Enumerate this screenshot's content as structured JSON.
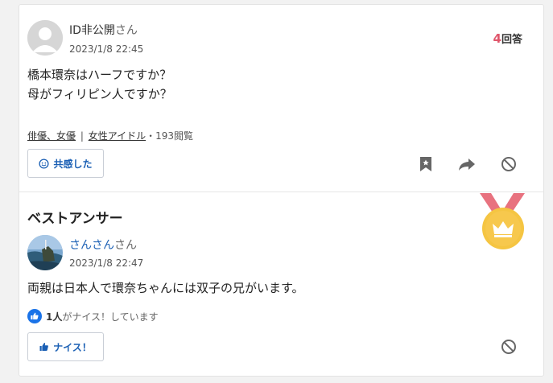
{
  "question": {
    "user_name": "ID非公開",
    "honorific": "さん",
    "date": "2023/1/8 22:45",
    "answer_count_number": "4",
    "answer_count_label": "回答",
    "text_line1": "橋本環奈はハーフですか？",
    "text_line2": "母がフィリピン人ですか？",
    "tag1": "俳優、女優",
    "separator": "|",
    "tag2": "女性アイドル",
    "views": "・193閲覧",
    "empathy_label": "共感した"
  },
  "best_answer": {
    "section_title": "ベストアンサー",
    "user_name": "さんさん",
    "honorific": "さん",
    "date": "2023/1/8 22:47",
    "text": "両親は日本人で環奈ちゃんには双子の兄がいます。",
    "nice_count": "1人",
    "nice_suffix": "がナイス！しています",
    "nice_label": "ナイス！"
  },
  "colors": {
    "accent_blue": "#1a5fb4",
    "answer_count_red": "#e0566b",
    "medal_gold": "#f5c542",
    "medal_ribbon": "#e8727f"
  },
  "icons": [
    "user-avatar-icon",
    "smile-icon",
    "bookmark-icon",
    "share-arrow-icon",
    "ban-icon",
    "medal-icon",
    "crown-icon",
    "thumbs-up-icon"
  ]
}
